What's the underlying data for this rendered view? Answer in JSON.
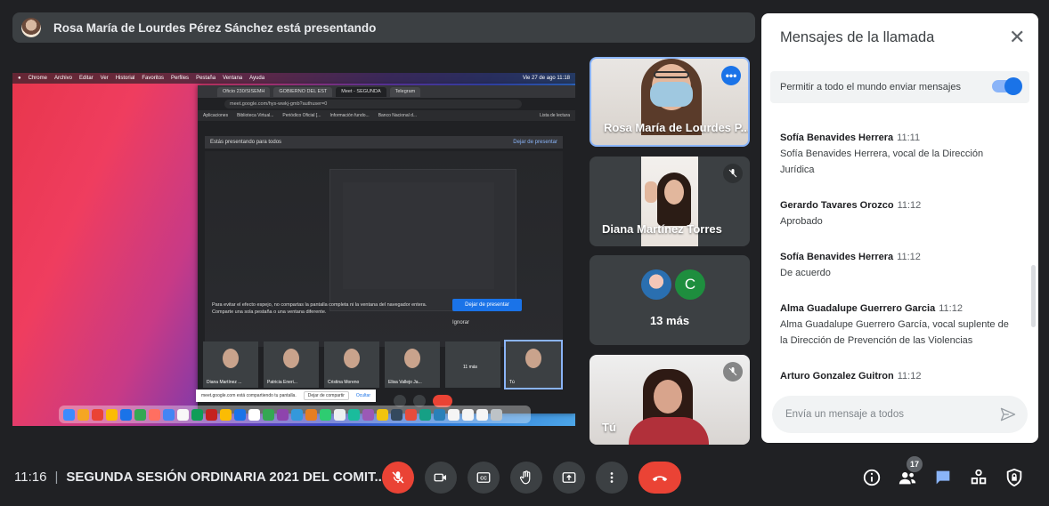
{
  "presenter_banner": {
    "text": "Rosa María de Lourdes Pérez Sánchez está presentando"
  },
  "shared_screen": {
    "mac_menu": [
      "Chrome",
      "Archivo",
      "Editar",
      "Ver",
      "Historial",
      "Favoritos",
      "Perfiles",
      "Pestaña",
      "Ventana",
      "Ayuda"
    ],
    "mac_clock": "Vie 27 de ago 11:18",
    "browser_tabs": [
      "Oficio 230/SISEMH",
      "GOBIERNO DEL EST",
      "Meet - SEGUNDA",
      "Telegram"
    ],
    "url": "meet.google.com/hys-wwkj-gmb?authuser=0",
    "bookmarks": [
      "Aplicaciones",
      "Biblioteca Virtual...",
      "Periódico Oficial [...",
      "Información fundo...",
      "Banco Nacional d...",
      "Lista de lectura"
    ],
    "presenting_text": "Estás presentando para todos",
    "stop_presenting_link": "Dejar de presentar",
    "mirror_warning": "Para evitar el efecto espejo, no compartas la pantalla completa ni la ventana del navegador entera. Comparte una sola pestaña o una ventana diferente.",
    "stop_button": "Dejar de presentar",
    "ignore_link": "Ignorar",
    "thumbs": [
      "Diana Martínez ...",
      "Patricia Eneri...",
      "Cristina Moreno",
      "Elisa Vallejo Ja...",
      "11 más",
      "Tú"
    ],
    "share_note": "meet.google.com está compartiendo tu pantalla.",
    "share_stop": "Dejar de compartir",
    "share_hide": "Ocultar"
  },
  "tiles": [
    {
      "name": "Rosa María de Lourdes P..."
    },
    {
      "name": "Diana Martínez Torres"
    },
    {
      "name": "13 más",
      "avatar_letter": "C"
    },
    {
      "name": "Tú"
    }
  ],
  "chat": {
    "title": "Mensajes de la llamada",
    "close_glyph": "✕",
    "allow_label": "Permitir a todo el mundo enviar mensajes",
    "messages": [
      {
        "author": "Sofía Benavides Herrera",
        "time": "11:11",
        "line1": "Sofía Benavides Herrera, vocal de la Dirección",
        "line2": "Jurídica"
      },
      {
        "author": "Gerardo Tavares Orozco",
        "time": "11:12",
        "line1": "Aprobado",
        "line2": ""
      },
      {
        "author": "Sofía Benavides Herrera",
        "time": "11:12",
        "line1": "De acuerdo",
        "line2": ""
      },
      {
        "author": "Alma Guadalupe Guerrero Garcia",
        "time": "11:12",
        "line1": "Alma Guadalupe Guerrero García, vocal suplente de",
        "line2": "la Dirección de Prevención de las Violencias"
      },
      {
        "author": "Arturo Gonzalez Guitron",
        "time": "11:12",
        "line1": "",
        "line2": ""
      }
    ],
    "compose_placeholder": "Envía un mensaje a todos"
  },
  "bottom_bar": {
    "time": "11:16",
    "separator": "|",
    "meeting_title": "SEGUNDA SESIÓN ORDINARIA 2021 DEL COMIT...",
    "participants_count": "17"
  },
  "colors": {
    "accent": "#1a73e8",
    "danger": "#ea4335",
    "bg": "#202124",
    "tile": "#3c4043"
  }
}
